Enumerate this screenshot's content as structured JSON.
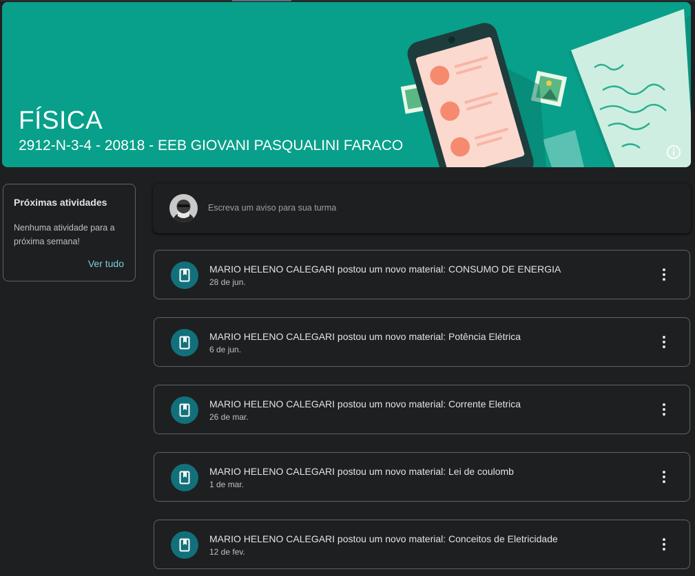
{
  "banner": {
    "title": "FÍSICA",
    "subtitle": "2912-N-3-4 - 20818 - EEB GIOVANI PASQUALINI FARACO"
  },
  "upcoming": {
    "heading": "Próximas atividades",
    "empty_text": "Nenhuma atividade para a próxima semana!",
    "view_all": "Ver tudo"
  },
  "composer": {
    "placeholder": "Escreva um aviso para sua turma"
  },
  "posts": [
    {
      "title": "MARIO HELENO CALEGARI postou um novo material: CONSUMO DE ENERGIA",
      "date": "28 de jun."
    },
    {
      "title": "MARIO HELENO CALEGARI postou um novo material: Potência Elétrica",
      "date": "6 de jun."
    },
    {
      "title": "MARIO HELENO CALEGARI postou um novo material: Corrente Eletrica",
      "date": "26 de mar."
    },
    {
      "title": "MARIO HELENO CALEGARI postou um novo material: Lei de coulomb",
      "date": "1 de mar."
    },
    {
      "title": "MARIO HELENO CALEGARI postou um novo material: Conceitos de Eletricidade",
      "date": "12 de fev."
    }
  ],
  "icons": {
    "post": "book-icon",
    "more": "more-vert-icon",
    "info": "info-icon"
  },
  "colors": {
    "banner": "#08a08a",
    "icon_circle": "#12707a",
    "link": "#7fcfd8",
    "background": "#1e1f21"
  }
}
